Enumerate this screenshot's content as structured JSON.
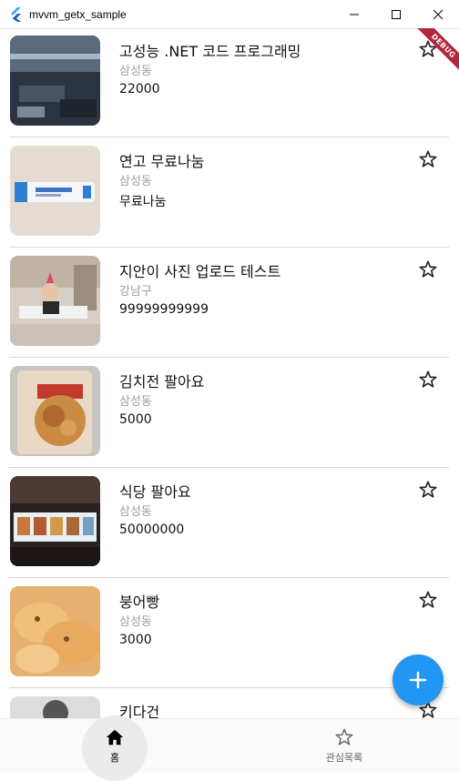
{
  "window": {
    "title": "mvvm_getx_sample"
  },
  "debug_label": "DEBUG",
  "items": [
    {
      "title": "고성능 .NET 코드 프로그래밍",
      "location": "삼성동",
      "price": "22000"
    },
    {
      "title": "연고 무료나눔",
      "location": "삼성동",
      "price": "무료나눔"
    },
    {
      "title": "지안이 사진 업로드 테스트",
      "location": "강남구",
      "price": "99999999999"
    },
    {
      "title": "김치전 팔아요",
      "location": "삼성동",
      "price": "5000"
    },
    {
      "title": "식당 팔아요",
      "location": "삼성동",
      "price": "50000000"
    },
    {
      "title": "붕어빵",
      "location": "삼성동",
      "price": "3000"
    },
    {
      "title": "키다건",
      "location": "",
      "price": ""
    }
  ],
  "bottom_nav": {
    "home_label": "홈",
    "favorites_label": "관심목록",
    "active": "home"
  },
  "colors": {
    "accent": "#2196f3",
    "debug_banner": "#b3263b",
    "subtext": "#9e9e9e"
  },
  "icons": {
    "app": "flutter-logo-icon",
    "favorite": "star-outline-icon",
    "add": "plus-icon",
    "home": "home-icon"
  }
}
